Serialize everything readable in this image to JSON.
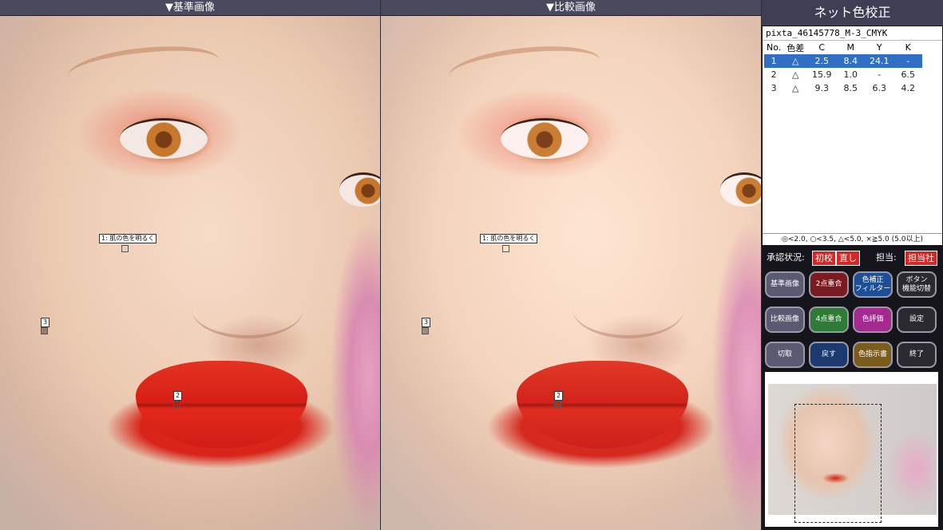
{
  "panes": {
    "left_title": "▼基準画像",
    "right_title": "▼比較画像",
    "markers": {
      "m1": "1: 肌の色を明るく",
      "m2": "2",
      "m3": "3"
    }
  },
  "panel": {
    "title": "ネット色校正",
    "filename": "pixta_46145778_M-3_CMYK",
    "table": {
      "headers": [
        "No.",
        "色差",
        "C",
        "M",
        "Y",
        "K"
      ],
      "rows": [
        [
          "1",
          "△",
          "2.5",
          "8.4",
          "24.1",
          "-"
        ],
        [
          "2",
          "△",
          "15.9",
          "1.0",
          "-",
          "6.5"
        ],
        [
          "3",
          "△",
          "9.3",
          "8.5",
          "6.3",
          "4.2"
        ]
      ]
    },
    "legend": "◎<2.0, ○<3.5, △<5.0, ×≧5.0 (5.0以上)",
    "approval_label": "承認状況:",
    "approval_tag1": "初校",
    "approval_tag2": "直し",
    "assignee_label": "担当:",
    "assignee_tag": "担当社",
    "buttons": {
      "b1": "基準画像",
      "b2": "2点重合",
      "b3": "色補正\nフィルター",
      "b4": "ボタン\n機能切替",
      "b5": "比較画像",
      "b6": "4点重合",
      "b7": "色評価",
      "b8": "設定",
      "b9": "切取",
      "b10": "戻す",
      "b11": "色指示書",
      "b12": "終了"
    }
  }
}
